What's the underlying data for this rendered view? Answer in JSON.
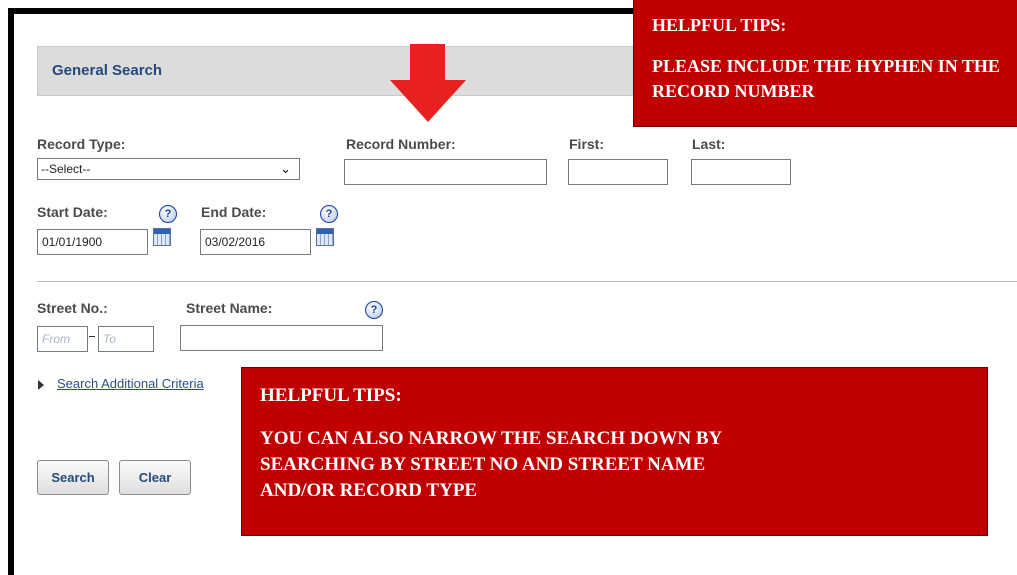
{
  "header": {
    "title": "General Search"
  },
  "fields": {
    "record_type": {
      "label": "Record Type:",
      "value": "--Select--"
    },
    "record_number": {
      "label": "Record Number:",
      "value": ""
    },
    "first": {
      "label": "First:",
      "value": ""
    },
    "last": {
      "label": "Last:",
      "value": ""
    },
    "start_date": {
      "label": "Start Date:",
      "value": "01/01/1900"
    },
    "end_date": {
      "label": "End Date:",
      "value": "03/02/2016"
    },
    "street_no": {
      "label": "Street No.:",
      "from_placeholder": "From",
      "to_placeholder": "To"
    },
    "street_name": {
      "label": "Street Name:",
      "value": ""
    }
  },
  "help_glyph": "?",
  "additional_criteria": {
    "label": "Search Additional Criteria"
  },
  "buttons": {
    "search": "Search",
    "clear": "Clear"
  },
  "tips": {
    "top": {
      "heading": "HELPFUL TIPS:",
      "lines": [
        "PLEASE INCLUDE THE HYPHEN IN THE",
        "RECORD NUMBER"
      ]
    },
    "bottom": {
      "heading": "HELPFUL TIPS:",
      "lines": [
        "YOU CAN ALSO NARROW THE SEARCH DOWN BY",
        "SEARCHING BY STREET NO AND STREET NAME",
        "AND/OR RECORD TYPE"
      ]
    }
  },
  "colors": {
    "tip_background": "#c00000",
    "arrow": "#e8201f",
    "header_text": "#264a7a"
  }
}
